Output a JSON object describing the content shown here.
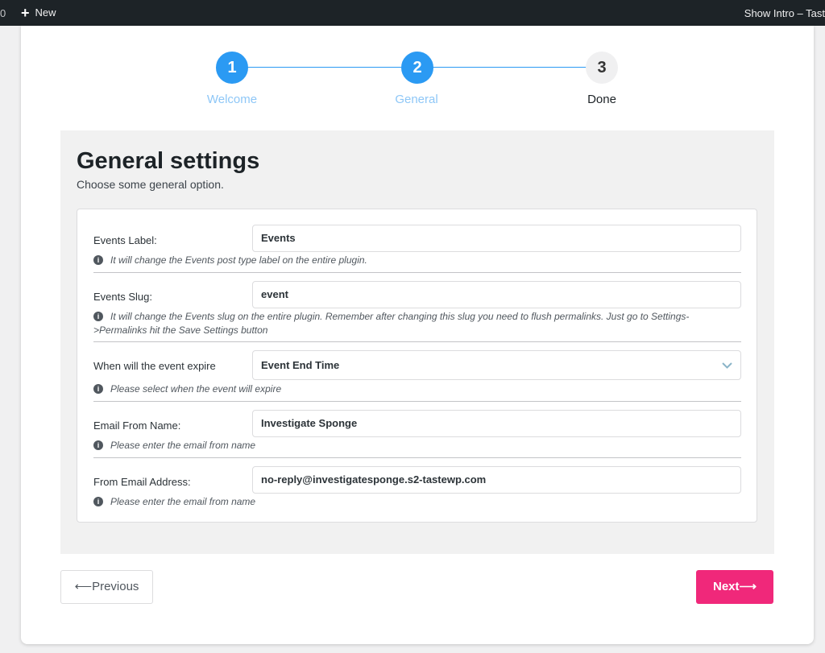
{
  "adminbar": {
    "count": "0",
    "new_label": "New",
    "right_label": "Show Intro – Tast"
  },
  "stepper": {
    "steps": [
      {
        "number": "1",
        "label": "Welcome",
        "status": "completed"
      },
      {
        "number": "2",
        "label": "General",
        "status": "current"
      },
      {
        "number": "3",
        "label": "Done",
        "status": "upcoming"
      }
    ],
    "active_color": "#2b9af3"
  },
  "page": {
    "title": "General settings",
    "subtitle": "Choose some general option."
  },
  "form": {
    "events_label": {
      "label": "Events Label:",
      "value": "Events",
      "help": "It will change the Events post type label on the entire plugin."
    },
    "events_slug": {
      "label": "Events Slug:",
      "value": "event",
      "help_line1": "It will change the Events slug on the entire plugin. Remember after changing this slug you need to flush permalinks. Just go to Settings-",
      "help_line2": ">Permalinks hit the Save Settings button"
    },
    "expire": {
      "label": "When will the event expire",
      "value": "Event End Time",
      "help": "Please select when the event will expire"
    },
    "email_from_name": {
      "label": "Email From Name:",
      "value": "Investigate Sponge",
      "help": "Please enter the email from name"
    },
    "from_email": {
      "label": "From Email Address:",
      "value": "no-reply@investigatesponge.s2-tastewp.com",
      "help": "Please enter the email from name"
    }
  },
  "nav": {
    "previous_label": "⟵Previous",
    "next_label": "Next⟶",
    "next_color": "#f0287a"
  }
}
